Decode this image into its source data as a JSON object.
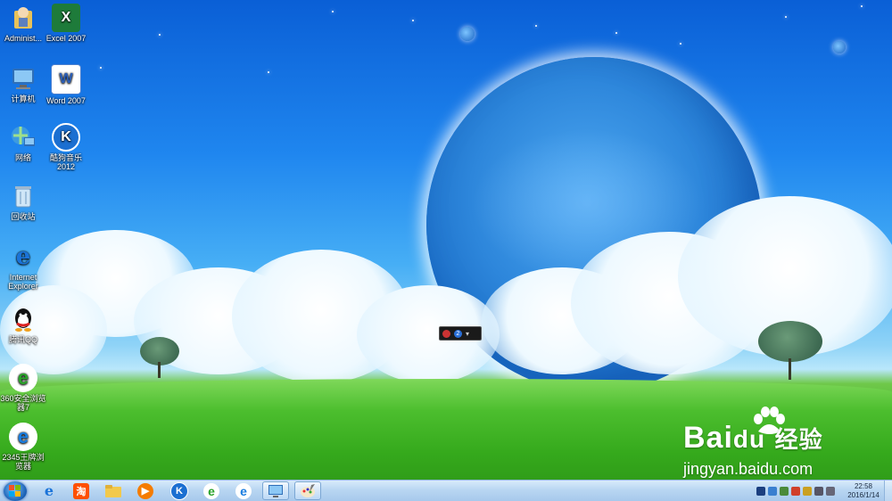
{
  "desktop": {
    "icons": [
      {
        "label": "Administ...",
        "icon": "user-folder-icon"
      },
      {
        "label": "Excel 2007",
        "icon": "excel-icon"
      },
      {
        "label": "计算机",
        "icon": "computer-icon"
      },
      {
        "label": "Word 2007",
        "icon": "word-icon"
      },
      {
        "label": "网络",
        "icon": "network-icon"
      },
      {
        "label": "酷狗音乐\n2012",
        "icon": "kugou-music-icon"
      },
      {
        "label": "回收站",
        "icon": "recycle-bin-icon"
      },
      {
        "label": "Internet\nExplorer",
        "icon": "internet-explorer-icon"
      },
      {
        "label": "腾讯QQ",
        "icon": "qq-icon"
      },
      {
        "label": "360安全浏览\n器7",
        "icon": "browser-360-icon"
      },
      {
        "label": "2345王牌浏\n览器",
        "icon": "browser-2345-icon"
      }
    ]
  },
  "watermark": {
    "brand": "Bai",
    "brand2": "du",
    "cn": "经验",
    "url": "jingyan.baidu.com"
  },
  "floatbar": {
    "badge": "2"
  },
  "taskbar": {
    "pinned": [
      {
        "name": "internet-explorer",
        "icon": "internet-explorer-icon"
      },
      {
        "name": "taobao",
        "label": "淘",
        "icon": "taobao-icon"
      },
      {
        "name": "file-explorer",
        "icon": "folder-icon"
      },
      {
        "name": "media-player",
        "icon": "media-player-icon"
      },
      {
        "name": "kugou",
        "label": "K",
        "icon": "kugou-icon"
      },
      {
        "name": "browser-360",
        "label": "e",
        "icon": "browser-360-icon"
      },
      {
        "name": "browser-2345",
        "label": "e",
        "icon": "browser-2345-icon"
      },
      {
        "name": "remote-desktop",
        "icon": "remote-desktop-icon"
      },
      {
        "name": "paint",
        "icon": "paint-icon"
      }
    ],
    "clock_time": "22:58",
    "clock_date": "2016/1/14",
    "colors": {
      "taskbar": "#b9d6f2",
      "start": "#1a5fb3"
    }
  }
}
